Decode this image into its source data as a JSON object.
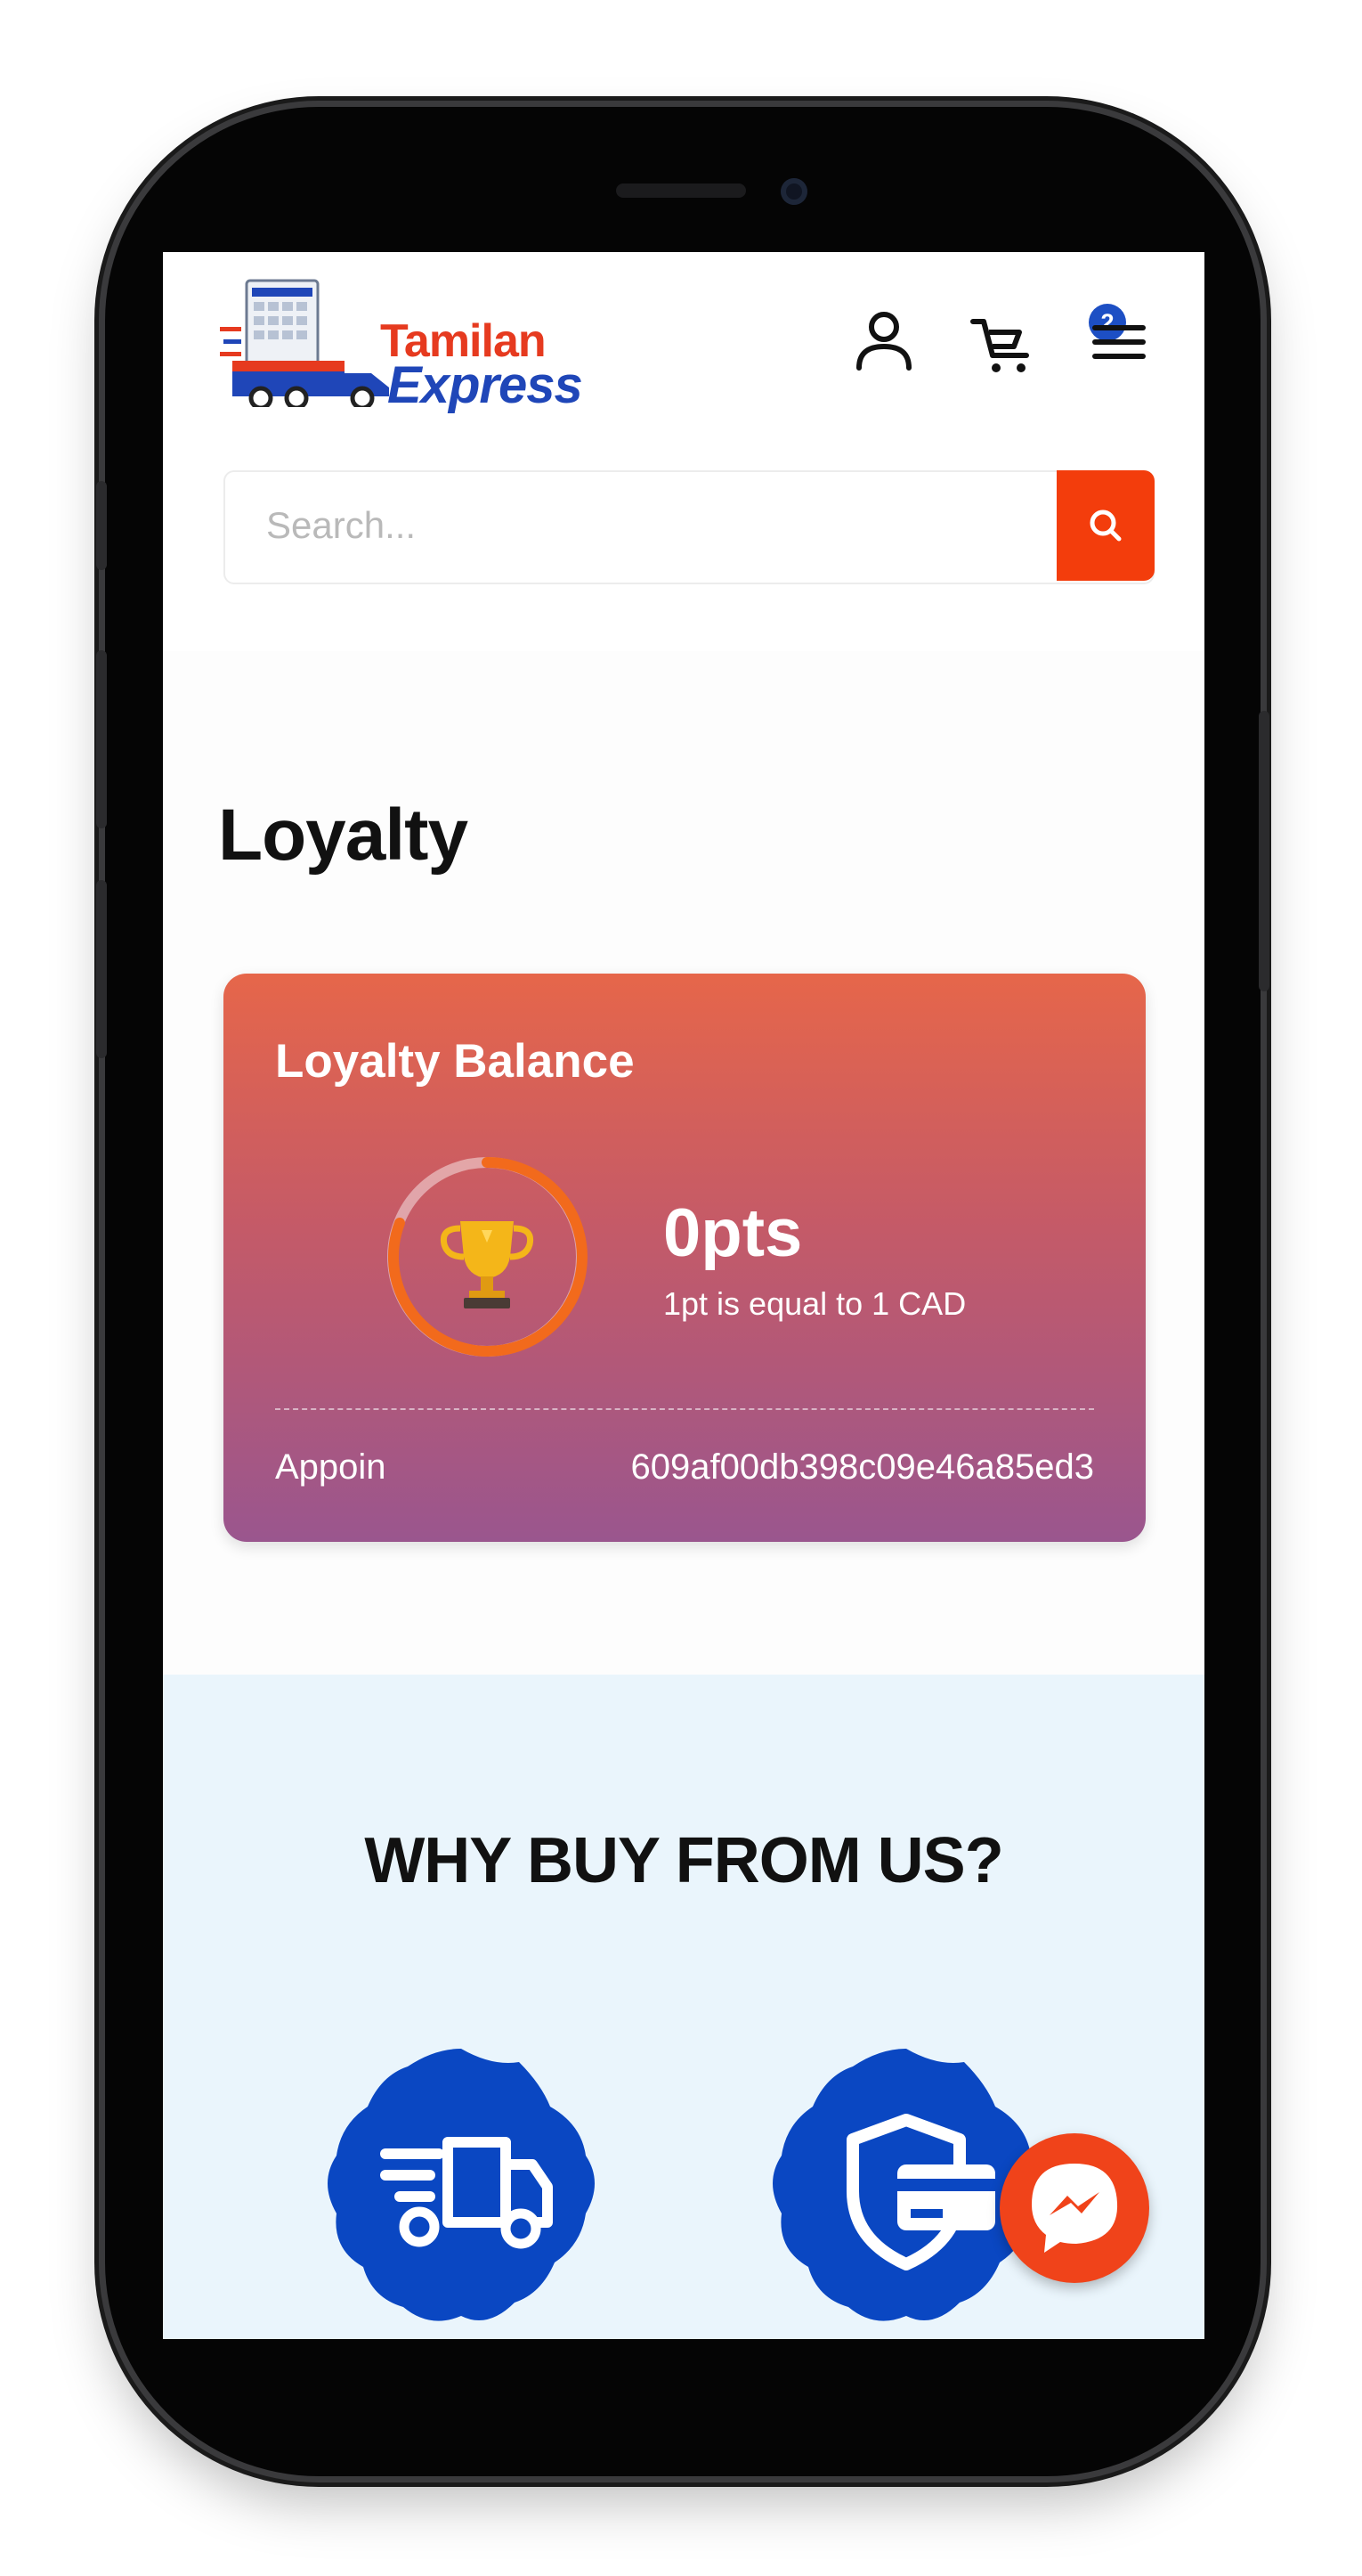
{
  "header": {
    "logo": {
      "line1": "Tamilan",
      "line2": "Express"
    },
    "account_icon": "user-icon",
    "cart_icon": "cart-icon",
    "cart_count": "2",
    "menu_icon": "hamburger-menu-icon"
  },
  "search": {
    "placeholder": "Search...",
    "button_icon": "search-icon"
  },
  "page": {
    "title": "Loyalty"
  },
  "loyalty_card": {
    "title": "Loyalty Balance",
    "points": "0pts",
    "conversion_note": "1pt is equal to 1 CAD",
    "label": "Appoin",
    "value": "609af00db398c09e46a85ed3",
    "icon": "trophy-icon"
  },
  "why_section": {
    "title": "WHY BUY FROM US?",
    "badges": [
      "delivery-truck-icon",
      "secure-payment-icon"
    ]
  },
  "chat": {
    "icon": "messenger-icon"
  },
  "colors": {
    "brand_orange": "#f33d0c",
    "brand_blue": "#1d4fc4",
    "badge_blue": "#0a47c2",
    "why_bg": "#eaf5fc"
  }
}
